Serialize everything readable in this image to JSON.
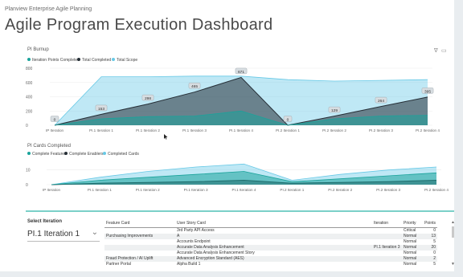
{
  "app": {
    "subtitle": "Planview Enterprise Agile Planning",
    "title": "Agile Program Execution Dashboard",
    "toolbar": {
      "filter_icon": "filter-icon",
      "expand_icon": "focus-mode-icon"
    }
  },
  "chart_data": [
    {
      "type": "area",
      "title": "PI Burnup",
      "categories": [
        "IP Iteration",
        "PI.1 Iteration 1",
        "PI.1 Iteration 2",
        "PI.1 Iteration 3",
        "PI.1 Iteration 4",
        "PI.2 Iteration 1",
        "PI.2 Iteration 2",
        "PI.2 Iteration 3",
        "PI.2 Iteration 4"
      ],
      "ylim": [
        0,
        800
      ],
      "yticks": [
        0,
        200,
        400,
        600,
        800
      ],
      "grid": true,
      "legend": "top-left",
      "series": [
        {
          "name": "Iteration Points Completed",
          "color": "#1aa39b",
          "values": [
            0,
            90,
            120,
            130,
            200,
            0,
            90,
            130,
            140
          ]
        },
        {
          "name": "Total Completed",
          "color": "#252e36",
          "values": [
            0,
            153,
            298,
            465,
            671,
            0,
            129,
            264,
            395
          ],
          "labels": [
            "0",
            "153",
            "298",
            "465",
            "671",
            "0",
            "129",
            "264",
            "395"
          ]
        },
        {
          "name": "Total Scope",
          "color": "#67c9e6",
          "values": [
            0,
            680,
            680,
            690,
            690,
            640,
            620,
            630,
            640
          ]
        }
      ]
    },
    {
      "type": "area",
      "title": "PI Cards Completed",
      "categories": [
        "IP Iteration",
        "PI.1 Iteration 1",
        "PI.1 Iteration 2",
        "PI.1 Iteration 3",
        "PI.1 Iteration 4",
        "PI.2 Iteration 1",
        "PI.2 Iteration 2",
        "PI.2 Iteration 3",
        "PI.2 Iteration 4"
      ],
      "ylim": [
        0,
        18
      ],
      "yticks": [
        0,
        10
      ],
      "grid": true,
      "legend": "top-left",
      "series": [
        {
          "name": "Complete Features",
          "color": "#1aa39b",
          "values": [
            0,
            3,
            5,
            7,
            9,
            2,
            4,
            6,
            8
          ]
        },
        {
          "name": "Complete Enablers",
          "color": "#252e36",
          "values": [
            0,
            1,
            1.5,
            2,
            3,
            1,
            1.5,
            2,
            3
          ]
        },
        {
          "name": "Completed Cards",
          "color": "#67c9e6",
          "values": [
            0,
            5,
            9,
            12,
            14,
            3,
            7,
            10,
            12
          ]
        }
      ]
    }
  ],
  "slicer": {
    "label": "Select Iteration",
    "value": "PI.1 Iteration 1"
  },
  "table": {
    "columns": [
      "Feature Card",
      "User Story Card",
      "Iteration",
      "Priority",
      "Points"
    ],
    "rows": [
      [
        "",
        "3rd Party API Access",
        "",
        "Critical",
        "0"
      ],
      [
        "Purchasing Improvements",
        "A",
        "",
        "Normal",
        "13"
      ],
      [
        "",
        "Accounts Endpoint",
        "",
        "Normal",
        "5"
      ],
      [
        "",
        "Accurate Data Analysis Enhancement",
        "PI.1 Iteration 3",
        "Normal",
        "20"
      ],
      [
        "",
        "Accurate Data Analysis Enhancement Story",
        "",
        "Normal",
        "0"
      ],
      [
        "Fraud Protection / AI Uplift",
        "Advanced Encryption Standard (AES)",
        "",
        "Normal",
        "2"
      ],
      [
        "Partner Portal",
        "Alpha Build 1",
        "",
        "Normal",
        "5"
      ]
    ]
  }
}
